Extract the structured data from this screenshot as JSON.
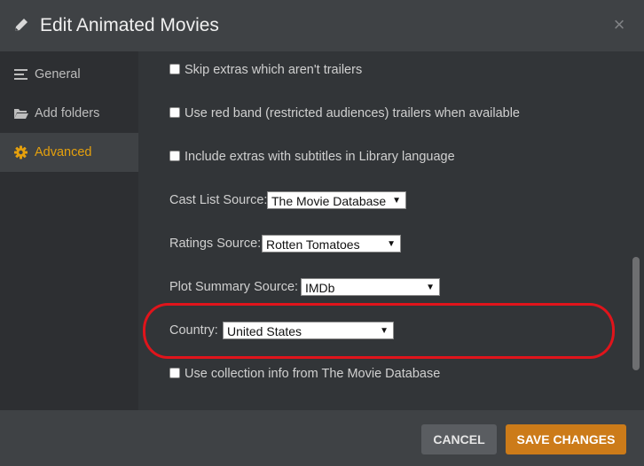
{
  "dialog": {
    "title": "Edit Animated Movies",
    "close_glyph": "×"
  },
  "sidebar": {
    "items": [
      {
        "label": "General",
        "icon": "list-icon"
      },
      {
        "label": "Add folders",
        "icon": "folder-icon"
      },
      {
        "label": "Advanced",
        "icon": "gear-icon",
        "active": true
      }
    ]
  },
  "settings": {
    "checkboxes": [
      {
        "label": "Skip extras which aren't trailers",
        "checked": false
      },
      {
        "label": "Use red band (restricted audiences) trailers when available",
        "checked": false
      },
      {
        "label": "Include extras with subtitles in Library language",
        "checked": false
      },
      {
        "label": "Use collection info from The Movie Database",
        "checked": false
      }
    ],
    "cast_list_source": {
      "label": "Cast List Source:",
      "value": "The Movie Database"
    },
    "ratings_source": {
      "label": "Ratings Source:",
      "value": "Rotten Tomatoes"
    },
    "plot_summary_source": {
      "label": "Plot Summary Source:",
      "value": "IMDb"
    },
    "country": {
      "label": "Country:",
      "value": "United States"
    }
  },
  "footer": {
    "cancel_label": "CANCEL",
    "save_label": "SAVE CHANGES"
  },
  "colors": {
    "accent": "#e5a00d",
    "save_button": "#cc7b19",
    "highlight_outline": "#e0141b"
  }
}
